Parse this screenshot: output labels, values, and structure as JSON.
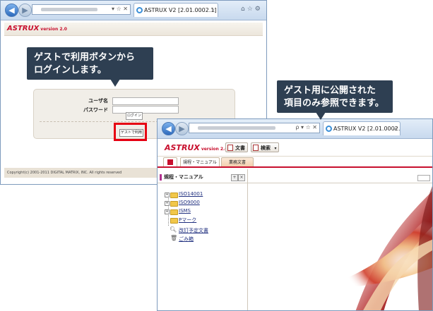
{
  "login_window": {
    "address_tail": "▾ ☆ ✕",
    "tab_label": "ASTRUX V2 [2.01.0002.1]",
    "tab_close": "×",
    "logo": "ASTRUX",
    "logo_version": "version 2.0",
    "username_label": "ユーザ名",
    "password_label": "パスワード",
    "login_button": "ログイン",
    "guest_button": "ゲストで利用",
    "footer": "Copyright(c) 2001-2011 DIGITAL MATRIX, INC. All rights reserved"
  },
  "callout_login": {
    "line1": "ゲストで利用ボタンから",
    "line2": "ログインします。"
  },
  "callout_guest": {
    "line1": "ゲスト用に公開された",
    "line2": "項目のみ参照できます。"
  },
  "guest_window": {
    "address_tail": "ρ ▾ ☆ ✕",
    "tab_label": "ASTRUX V2 [2.01.0002.1]",
    "tab_close": "×",
    "logo": "ASTRUX",
    "logo_version": "version 2.0",
    "toolbar": {
      "document_button": "文書",
      "search_button": "検索"
    },
    "menu_tabs": {
      "kitei": "規程・マニュアル",
      "gyomu": "業務文書"
    },
    "left_panel": {
      "title": "規程・マニュアル",
      "tree": [
        "ISO14001",
        "ISO9000",
        "ISMS",
        "Pマーク",
        "改訂予定文書",
        "ごみ箱"
      ]
    }
  },
  "colors": {
    "brand_red": "#c8102e",
    "callout_bg": "#2e3f52",
    "highlight_red": "#e60012"
  }
}
